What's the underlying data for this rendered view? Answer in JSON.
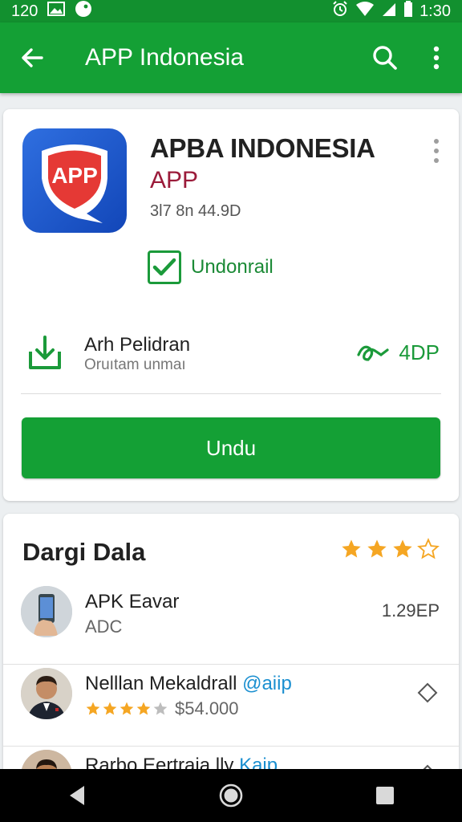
{
  "status_bar": {
    "left_text": "120",
    "time": "1:30"
  },
  "app_bar": {
    "title": "APP Indonesia"
  },
  "app": {
    "name": "APBA INDONESIA",
    "developer": "APP",
    "meta": "3l7 8n  44.9D",
    "icon_text": "APP",
    "checkbox_label": "Undonrail"
  },
  "download_row": {
    "title": "Arh Pelidran",
    "subtitle": "Oruıtam unmaı",
    "right_value": "4DP"
  },
  "install_button": {
    "label": "Undu"
  },
  "section": {
    "title": "Dargi Dala",
    "rating": 3.5
  },
  "list": [
    {
      "title": "APK Eavar",
      "highlight": "",
      "subtitle": "ADC",
      "right": "1.29EP",
      "rating": null
    },
    {
      "title": "Nelllan Mekaldrall",
      "highlight": "@aiip",
      "subtitle": "$54.000",
      "right": "",
      "rating": 4
    },
    {
      "title": "Rarbo Eertraia lly",
      "highlight": "Kaip",
      "subtitle": "",
      "right": "",
      "rating": null
    }
  ],
  "colors": {
    "primary": "#14a035",
    "status": "#12902f",
    "star": "#f5a623",
    "developer": "#9b1b3a",
    "link": "#1a8fd0"
  },
  "icons": [
    "back-arrow-icon",
    "search-icon",
    "more-vert-icon",
    "check-icon",
    "download-icon",
    "pulse-icon",
    "star-icon",
    "diamond-icon",
    "nav-back-icon",
    "nav-home-icon",
    "nav-recents-icon"
  ]
}
